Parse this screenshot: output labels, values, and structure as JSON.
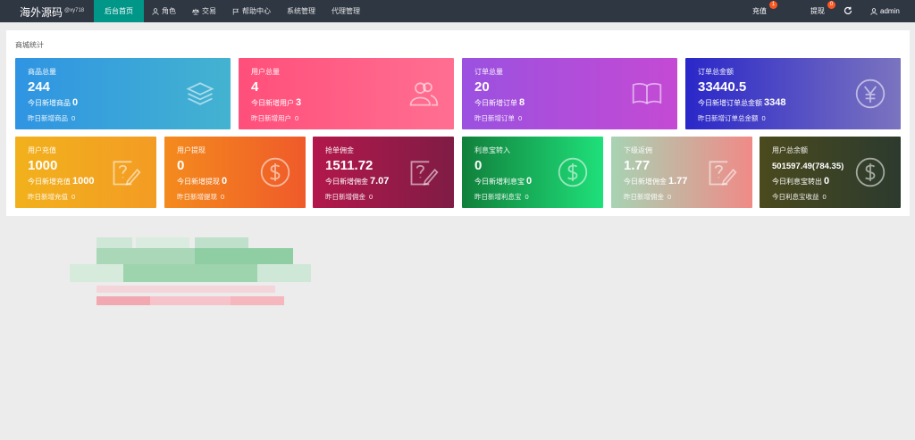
{
  "header": {
    "logo": "海外源码",
    "logo_sup": "@xy718",
    "nav": [
      {
        "label": "后台首页",
        "icon": "home",
        "active": true
      },
      {
        "label": "角色",
        "icon": "user-icon"
      },
      {
        "label": "交易",
        "icon": "scale-icon"
      },
      {
        "label": "帮助中心",
        "icon": "flag-icon"
      },
      {
        "label": "系统管理",
        "icon": ""
      },
      {
        "label": "代理管理",
        "icon": ""
      }
    ],
    "right": {
      "recharge": "充值",
      "recharge_badge": "1",
      "withdraw": "提现",
      "withdraw_badge": "0",
      "user": "admin"
    }
  },
  "panel": {
    "title": "商城统计"
  },
  "cards_row1": [
    {
      "title": "商品总量",
      "value": "244",
      "l1": "今日新增商品",
      "l1v": "0",
      "l2": "昨日新增商品",
      "l2v": "0",
      "icon": "layers-icon",
      "bg": "linear-gradient(90deg,#2f94e3,#43b3d0)"
    },
    {
      "title": "用户总量",
      "value": "4",
      "l1": "今日新增用户",
      "l1v": "3",
      "l2": "昨日新增用户",
      "l2v": "0",
      "icon": "users-icon",
      "bg": "linear-gradient(90deg,#ff4f7b,#ff6f91)"
    },
    {
      "title": "订单总量",
      "value": "20",
      "l1": "今日新增订单",
      "l1v": "8",
      "l2": "昨日新增订单",
      "l2v": "0",
      "icon": "book-icon",
      "bg": "linear-gradient(90deg,#9b51e0,#c44ad4)"
    },
    {
      "title": "订单总金额",
      "value": "33440.5",
      "l1": "今日新增订单总金额",
      "l1v": "3348",
      "l2": "昨日新增订单总金额",
      "l2v": "0",
      "icon": "yen-icon",
      "bg": "linear-gradient(90deg,#2a27c9,#7b74bf)"
    }
  ],
  "cards_row2": [
    {
      "title": "用户充值",
      "value": "1000",
      "l1": "今日新增充值",
      "l1v": "1000",
      "l2": "昨日新增充值",
      "l2v": "0",
      "icon": "edit-icon",
      "bg": "linear-gradient(90deg,#f2b11c,#f39c24)"
    },
    {
      "title": "用户提现",
      "value": "0",
      "l1": "今日新增提现",
      "l1v": "0",
      "l2": "昨日新增提现",
      "l2v": "0",
      "icon": "dollar-icon",
      "bg": "linear-gradient(90deg,#f48b1d,#ef5a2a)"
    },
    {
      "title": "抢单佣金",
      "value": "1511.72",
      "l1": "今日新增佣金",
      "l1v": "7.07",
      "l2": "昨日新增佣金",
      "l2v": "0",
      "icon": "edit-icon",
      "bg": "linear-gradient(90deg,#b2184b,#7f1c45)"
    },
    {
      "title": "利息宝转入",
      "value": "0",
      "l1": "今日新增利息宝",
      "l1v": "0",
      "l2": "昨日新增利息宝",
      "l2v": "0",
      "icon": "dollar-icon",
      "bg": "linear-gradient(90deg,#11803b,#1fe07a)"
    },
    {
      "title": "下级返佣",
      "value": "1.77",
      "l1": "今日新增佣金",
      "l1v": "1.77",
      "l2": "昨日新增佣金",
      "l2v": "0",
      "icon": "edit-icon",
      "bg": "linear-gradient(90deg,#a7d3b3,#f08a87)"
    },
    {
      "title": "用户总余额",
      "value": "501597.49(784.35)",
      "l1": "今日利息宝转出",
      "l1v": "0",
      "l2": "今日利息宝收益",
      "l2v": "0",
      "icon": "dollar-icon",
      "bg": "linear-gradient(90deg,#4a4a1d,#2c3a2e)"
    }
  ]
}
